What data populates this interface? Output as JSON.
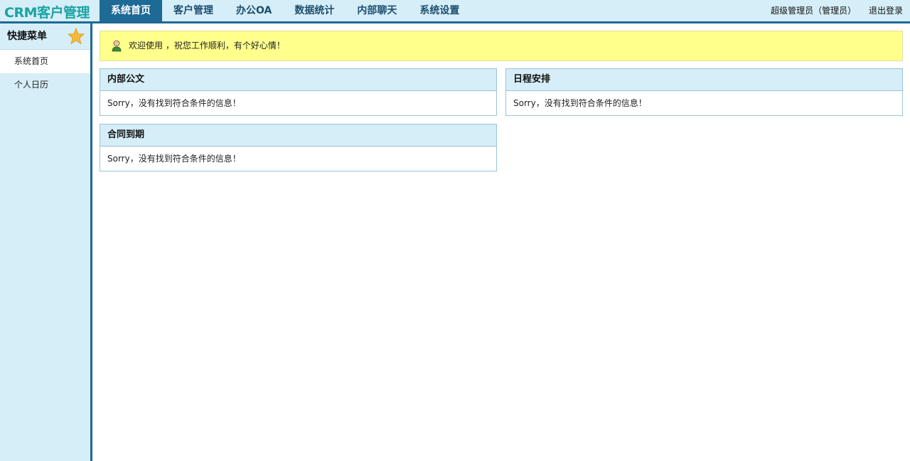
{
  "app": {
    "title": "CRM客户管理"
  },
  "nav": {
    "items": [
      {
        "label": "系统首页"
      },
      {
        "label": "客户管理"
      },
      {
        "label": "办公OA"
      },
      {
        "label": "数据统计"
      },
      {
        "label": "内部聊天"
      },
      {
        "label": "系统设置"
      }
    ],
    "active_index": 0
  },
  "user": {
    "name": "超级管理员（管理员）",
    "logout": "退出登录"
  },
  "sidebar": {
    "title": "快捷菜单",
    "items": [
      {
        "label": "系统首页"
      },
      {
        "label": "个人日历"
      }
    ]
  },
  "welcome": {
    "text": "欢迎使用 ，祝您工作顺利，有个好心情！"
  },
  "panels": [
    {
      "title": "内部公文",
      "message": "Sorry，没有找到符合条件的信息！"
    },
    {
      "title": "日程安排",
      "message": "Sorry，没有找到符合条件的信息！"
    },
    {
      "title": "合同到期",
      "message": "Sorry，没有找到符合条件的信息！"
    }
  ],
  "colors": {
    "accent": "#1d6a96",
    "header_bg": "#d6eef8",
    "logo": "#1aa3a3",
    "welcome_bg": "#ffff8c",
    "star": "#f5b93a"
  },
  "icons": {
    "sidebar_star": "star-icon",
    "welcome_user": "user-icon"
  }
}
